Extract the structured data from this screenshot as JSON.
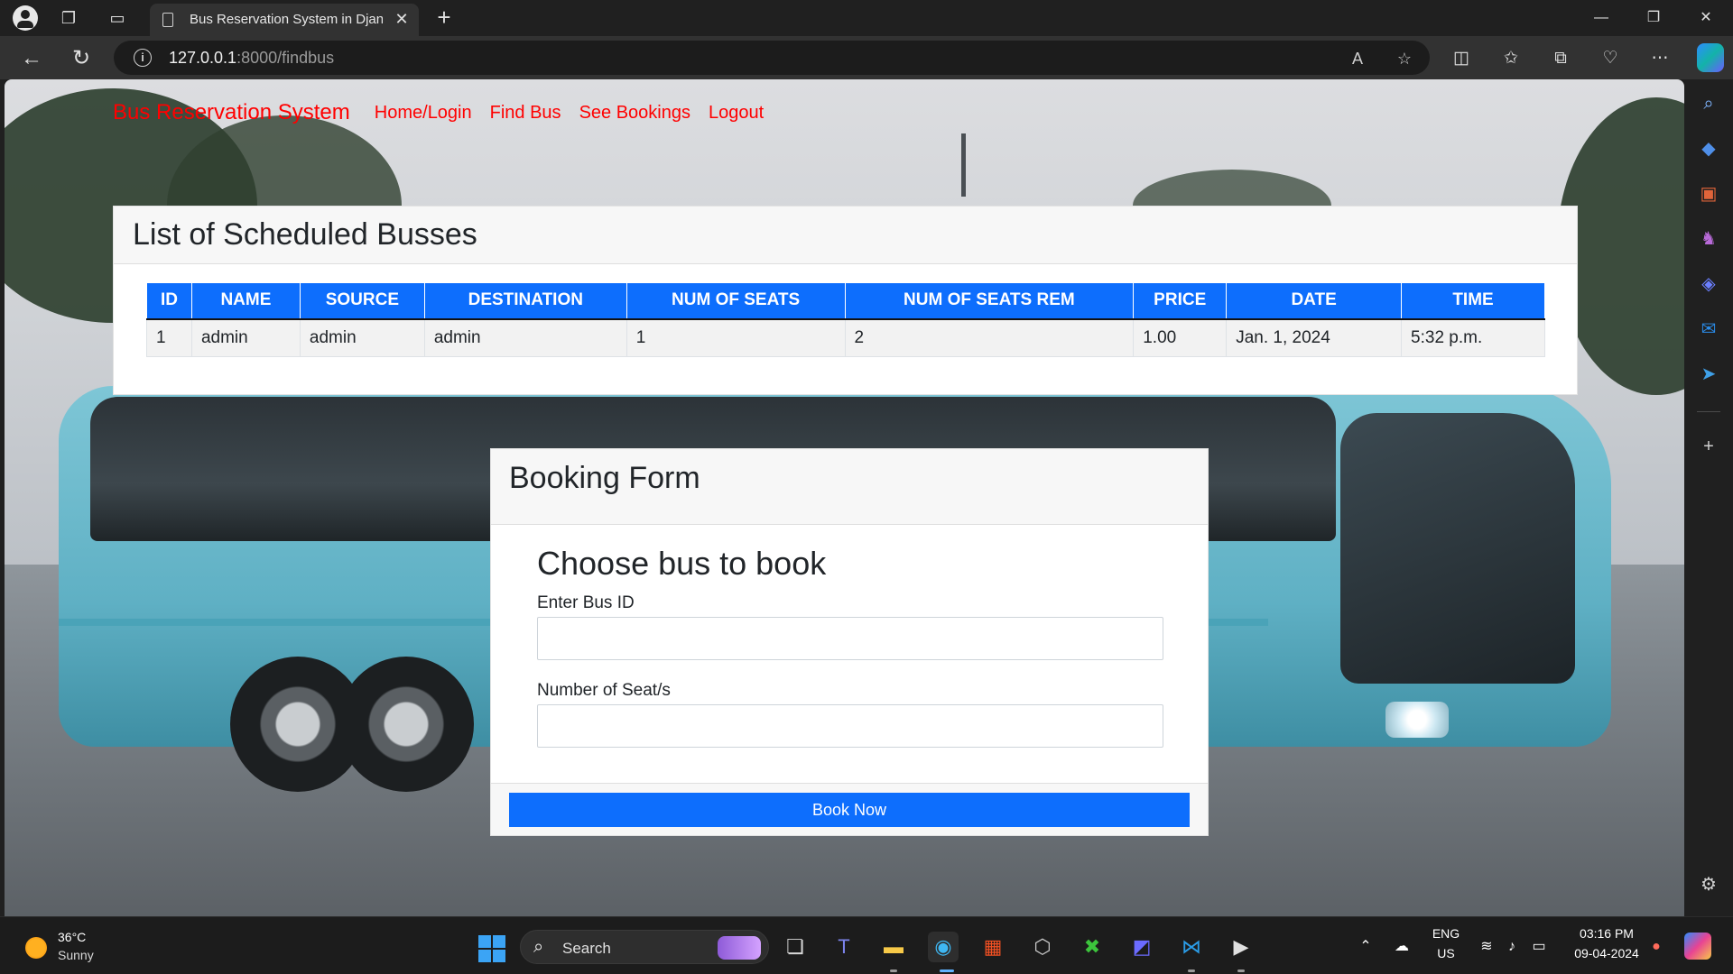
{
  "browser": {
    "tab_title": "Bus Reservation System in Djang",
    "url_host": "127.0.0.1",
    "url_rest": ":8000/findbus"
  },
  "app_nav": {
    "brand": "Bus Reservation System",
    "links": [
      "Home/Login",
      "Find Bus",
      "See Bookings",
      "Logout"
    ]
  },
  "bus_list": {
    "title": "List of Scheduled Busses",
    "columns": [
      "ID",
      "NAME",
      "SOURCE",
      "DESTINATION",
      "NUM OF SEATS",
      "NUM OF SEATS REM",
      "PRICE",
      "DATE",
      "TIME"
    ],
    "rows": [
      [
        "1",
        "admin",
        "admin",
        "admin",
        "1",
        "2",
        "1.00",
        "Jan. 1, 2024",
        "5:32 p.m."
      ]
    ]
  },
  "booking_form": {
    "title": "Booking Form",
    "heading": "Choose bus to book",
    "bus_id_label": "Enter Bus ID",
    "bus_id_value": "",
    "seats_label": "Number of Seat/s",
    "seats_value": "",
    "submit_label": "Book Now"
  },
  "taskbar": {
    "weather_temp": "36°C",
    "weather_desc": "Sunny",
    "search_label": "Search",
    "lang_top": "ENG",
    "lang_bottom": "US",
    "time": "03:16 PM",
    "date": "09-04-2024"
  },
  "colors": {
    "brand_red": "#ff0000",
    "primary_blue": "#0d6efd"
  }
}
